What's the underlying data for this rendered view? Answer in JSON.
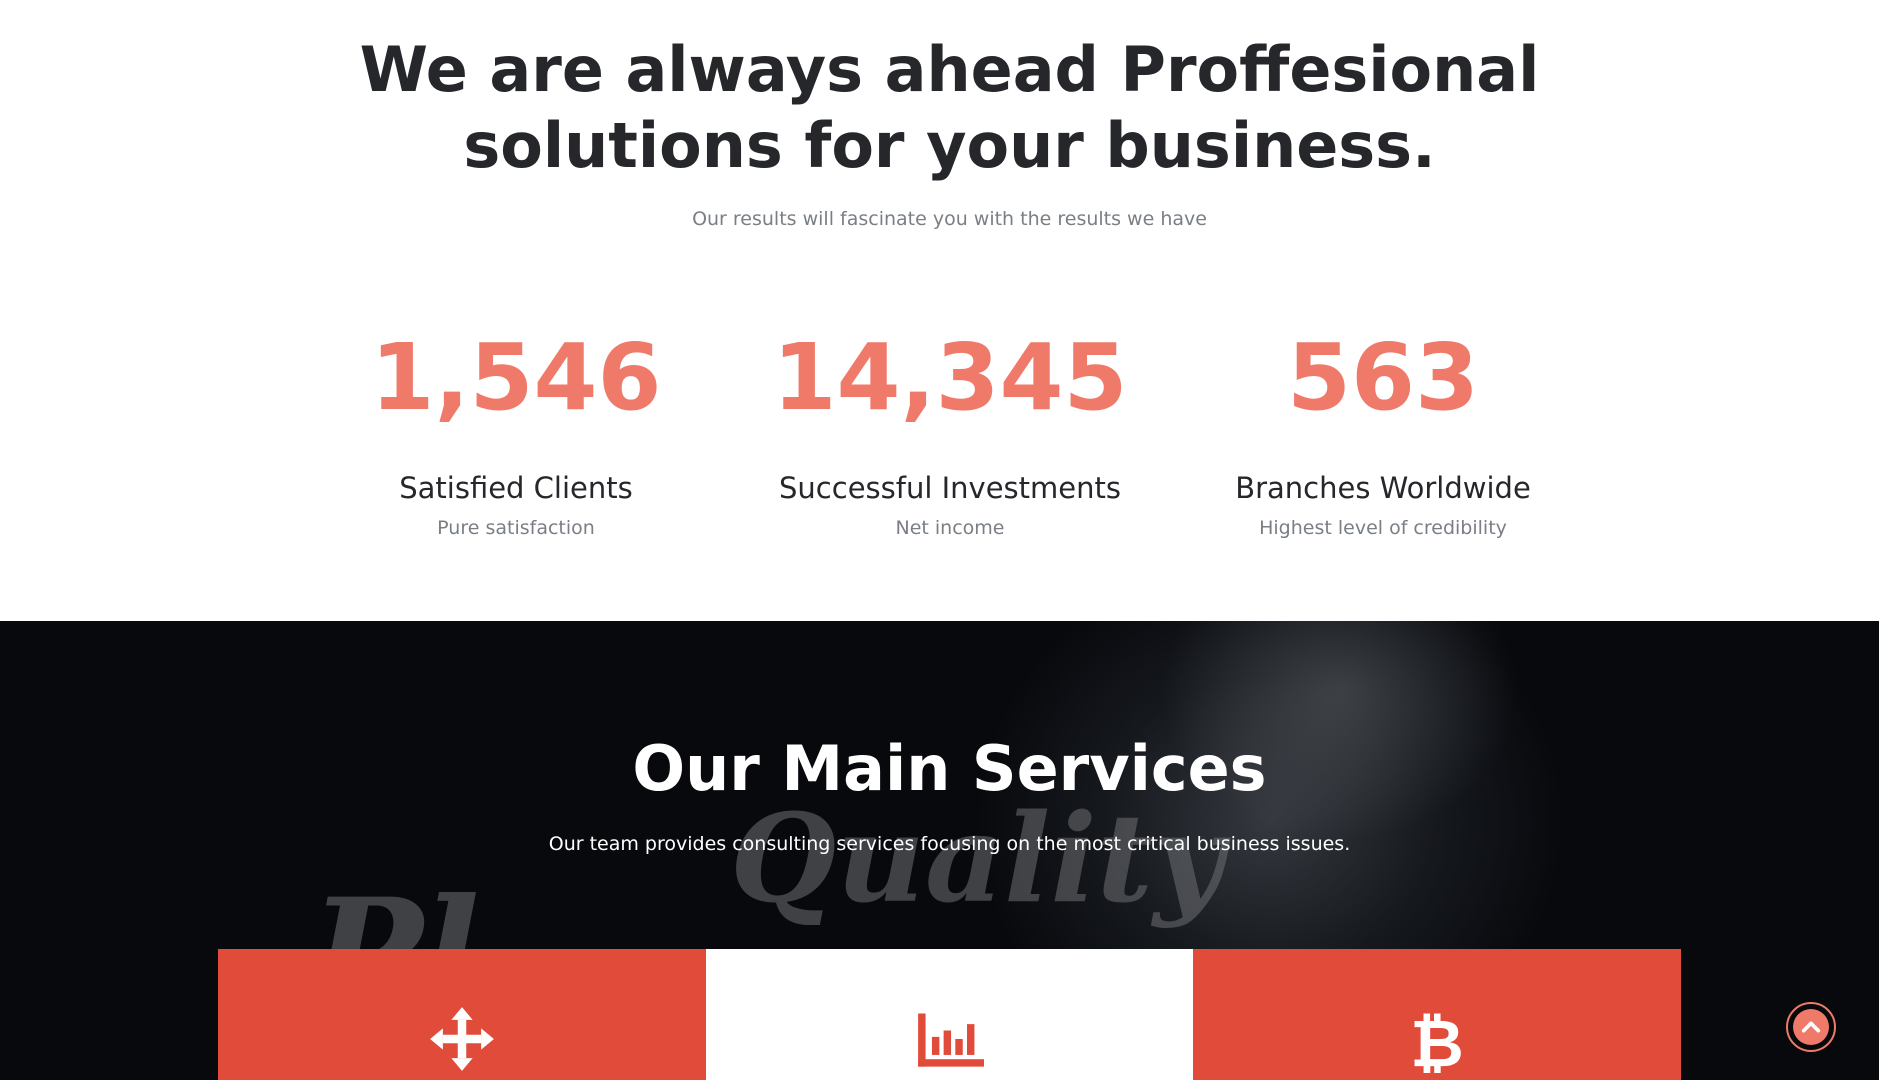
{
  "stats_section": {
    "headline_line1": "We are always ahead Proffesional",
    "headline_line2": "solutions for your business.",
    "subheading": "Our results will fascinate you with the results we have",
    "stats": [
      {
        "value": "1,546",
        "title": "Satisfied Clients",
        "subtitle": "Pure satisfaction"
      },
      {
        "value": "14,345",
        "title": "Successful Investments",
        "subtitle": "Net income"
      },
      {
        "value": "563",
        "title": "Branches Worldwide",
        "subtitle": "Highest level of credibility"
      }
    ]
  },
  "services_section": {
    "title": "Our Main Services",
    "subtitle": "Our team provides consulting services focusing on the most critical business issues.",
    "background_words": [
      "Quality",
      "Pl"
    ],
    "cards": [
      {
        "icon": "arrows-move-icon"
      },
      {
        "icon": "bar-chart-icon"
      },
      {
        "icon": "bitcoin-icon"
      }
    ]
  },
  "scroll_top": {
    "icon": "chevron-up-icon"
  },
  "colors": {
    "accent": "#f07a6a",
    "card_red": "#e04b3a",
    "heading": "#25272b",
    "muted": "#7a7f85",
    "dark_bg": "#07090d"
  }
}
